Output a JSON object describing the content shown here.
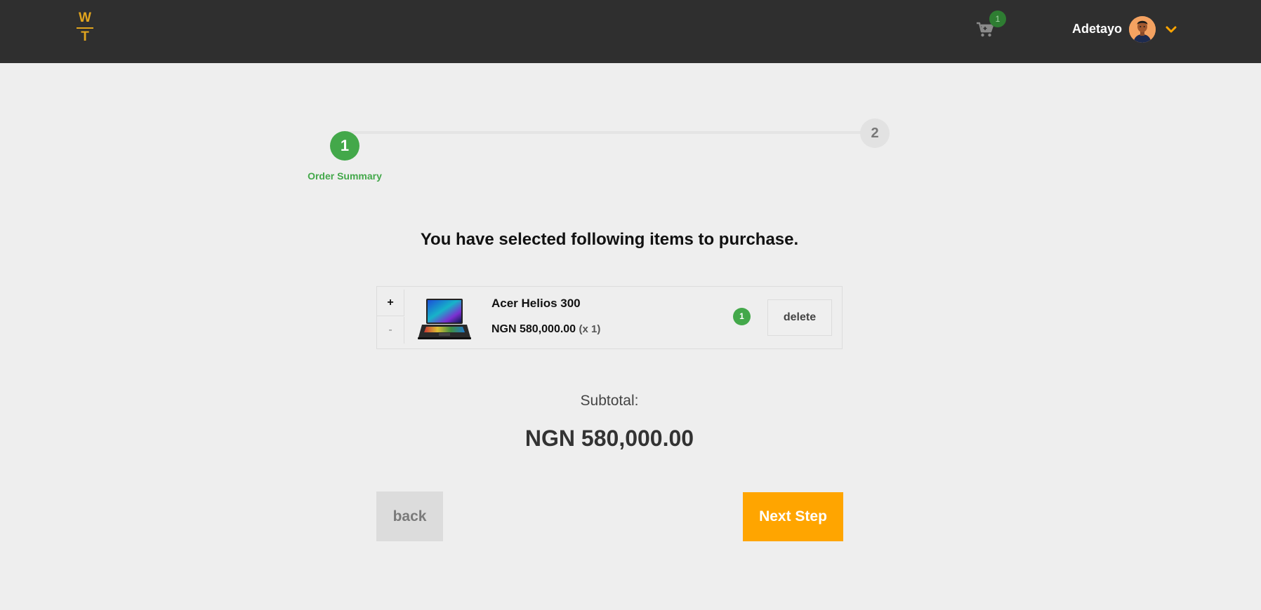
{
  "header": {
    "logo_top": "W",
    "logo_bottom": "T",
    "cart_count": "1",
    "username": "Adetayo"
  },
  "stepper": {
    "step1_number": "1",
    "step1_label": "Order Summary",
    "step2_number": "2"
  },
  "main": {
    "heading": "You have selected following items to purchase.",
    "items": [
      {
        "plus": "+",
        "minus": "-",
        "name": "Acer Helios 300",
        "price": "NGN 580,000.00",
        "qty_text": "(x 1)",
        "count": "1",
        "delete_label": "delete"
      }
    ],
    "subtotal_label": "Subtotal:",
    "subtotal_value": "NGN 580,000.00"
  },
  "actions": {
    "back_label": "back",
    "next_label": "Next Step"
  },
  "colors": {
    "header_bg": "#2f2f2f",
    "accent_orange": "#ffa500",
    "success_green": "#43a84a",
    "page_bg": "#eeeeee"
  },
  "icons": [
    "logo-icon",
    "cart-icon",
    "avatar",
    "chevron-down-icon",
    "laptop-image"
  ]
}
